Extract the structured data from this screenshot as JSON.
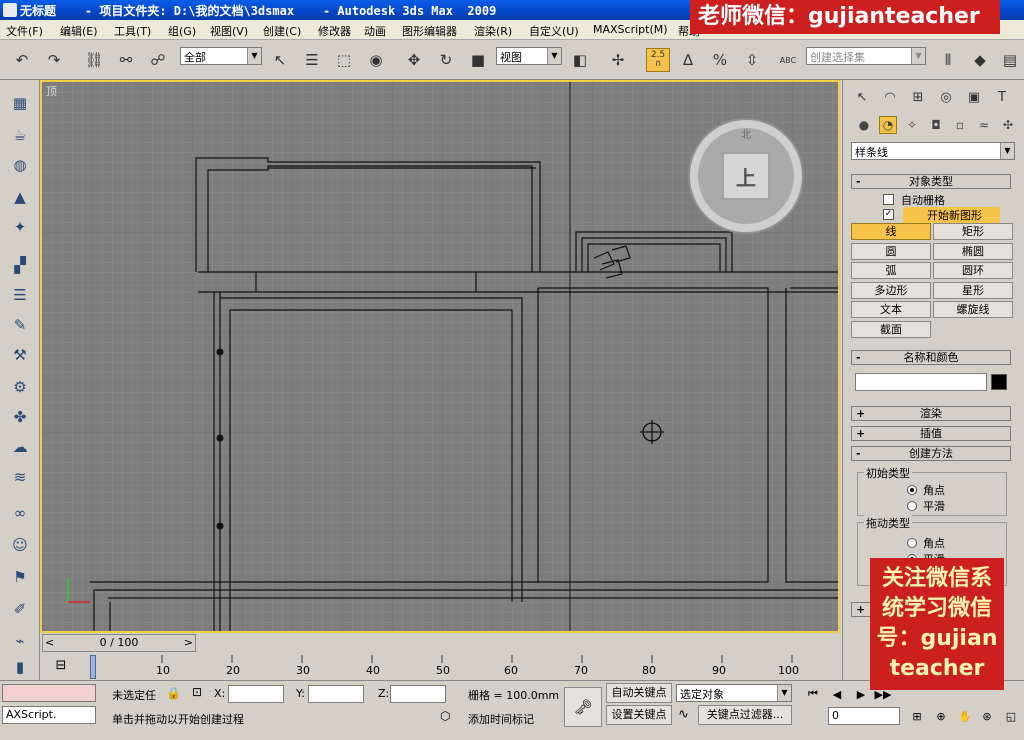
{
  "titlebar": {
    "title": "无标题    - 项目文件夹: D:\\我的文档\\3dsmax    - Autodesk 3ds Max  2009"
  },
  "menubar": {
    "items": [
      "文件(F)",
      "编辑(E)",
      "工具(T)",
      "组(G)",
      "视图(V)",
      "创建(C)",
      "修改器",
      "动画",
      "图形编辑器",
      "渲染(R)",
      "自定义(U)",
      "MAXScript(M)",
      "帮助"
    ]
  },
  "toolbar": {
    "filter_combo": "全部",
    "refcoord_combo": "视图",
    "snap_label": "2.5",
    "named_selection_placeholder": "创建选择集",
    "abc_label": "ABC"
  },
  "viewport": {
    "label": "顶",
    "viewcube_face": "上",
    "viewcube_north": "北"
  },
  "timebar": {
    "slider_text": "0 / 100"
  },
  "ruler": {
    "ticks": [
      "10",
      "20",
      "30",
      "40",
      "50",
      "60",
      "70",
      "80",
      "90",
      "100"
    ]
  },
  "command_panel": {
    "category_combo": "样条线",
    "rollouts": {
      "object_type": "对象类型",
      "name_color": "名称和颜色",
      "rendering": "渲染",
      "interpolation": "插值",
      "creation_method": "创建方法"
    },
    "autogrid": "自动栅格",
    "start_new_shape": "开始新图形",
    "objects": [
      "线",
      "矩形",
      "圆",
      "椭圆",
      "弧",
      "圆环",
      "多边形",
      "星形",
      "文本",
      "螺旋线",
      "截面"
    ],
    "initial_type": {
      "title": "初始类型",
      "options": [
        "角点",
        "平滑"
      ]
    },
    "drag_type": {
      "title": "拖动类型",
      "options": [
        "角点",
        "平滑"
      ]
    },
    "colors": {
      "swatch": "#000000"
    }
  },
  "statusbar": {
    "maxscript_label": "AXScript.",
    "selection_text": "未选定任",
    "x_label": "X:",
    "y_label": "Y:",
    "z_label": "Z:",
    "grid_label": "栅格 = 100.0mm",
    "prompt_text": "单击并拖动以开始创建过程",
    "add_time_tag": "添加时间标记",
    "auto_key": "自动关键点",
    "set_key": "设置关键点",
    "selected_object_combo": "选定对象",
    "key_filter": "关键点过滤器...",
    "frame_field": "0"
  },
  "watermarks": {
    "top": "老师微信：gujianteacher",
    "bottom": "关注微信系\n统学习微信\n号：gujian\nteacher"
  }
}
